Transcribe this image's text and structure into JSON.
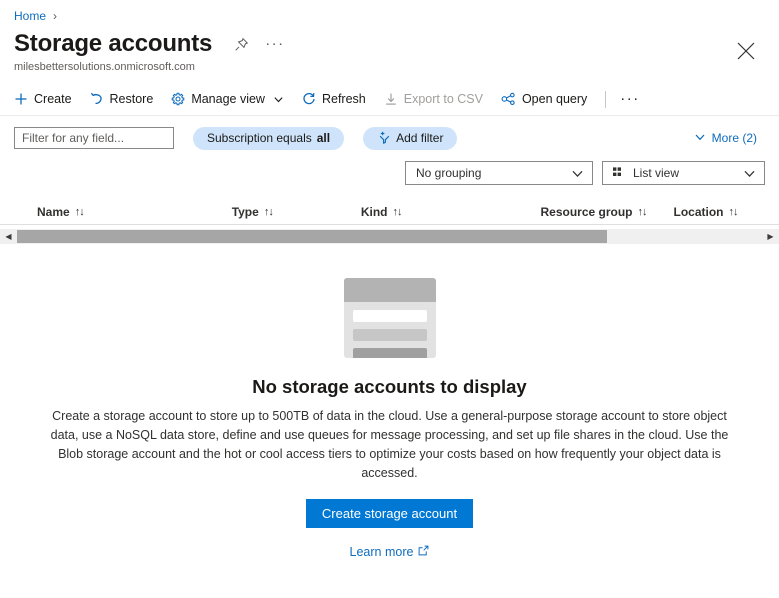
{
  "breadcrumb": {
    "home": "Home",
    "separator": "›"
  },
  "header": {
    "title": "Storage accounts",
    "subtitle": "milesbettersolutions.onmicrosoft.com",
    "pin_icon": "pin-icon",
    "ellipsis": "···",
    "close_icon": "close-icon"
  },
  "commandbar": {
    "items": [
      {
        "label": "Create",
        "icon": "plus-icon",
        "disabled": false
      },
      {
        "label": "Restore",
        "icon": "undo-arrow-icon",
        "disabled": false
      },
      {
        "label": "Manage view",
        "icon": "gear-icon",
        "disabled": false,
        "has_chevron": true
      },
      {
        "label": "Refresh",
        "icon": "refresh-icon",
        "disabled": false
      },
      {
        "label": "Export to CSV",
        "icon": "download-icon",
        "disabled": true
      },
      {
        "label": "Open query",
        "icon": "share-nodes-icon",
        "disabled": false
      }
    ],
    "overflow_ellipsis": "···"
  },
  "filterbar": {
    "filter_placeholder": "Filter for any field...",
    "filter_value": "",
    "subscription_chip": {
      "prefix": "Subscription equals ",
      "value": "all"
    },
    "add_filter_label": "Add filter",
    "add_filter_icon": "add-filter-icon",
    "more_label": "More (2)",
    "more_icon": "chevron-down-icon"
  },
  "selectors": {
    "grouping": {
      "value": "No grouping",
      "chevron": "chevron-down-icon"
    },
    "view": {
      "value": "List view",
      "icon": "list-view-icon",
      "chevron": "chevron-down-icon"
    }
  },
  "table": {
    "columns": [
      {
        "label": "Name",
        "sort": "↑↓"
      },
      {
        "label": "Type",
        "sort": "↑↓"
      },
      {
        "label": "Kind",
        "sort": "↑↓"
      },
      {
        "label": "Resource group",
        "sort": "↑↓"
      },
      {
        "label": "Location",
        "sort": "↑↓"
      }
    ],
    "rows": []
  },
  "scrollbar": {
    "left_arrow": "◀",
    "right_arrow": "▶"
  },
  "empty_state": {
    "illustration": "empty-table-illustration",
    "title": "No storage accounts to display",
    "description": "Create a storage account to store up to 500TB of data in the cloud. Use a general-purpose storage account to store object data, use a NoSQL data store, define and use queues for message processing, and set up file shares in the cloud. Use the Blob storage account and the hot or cool access tiers to optimize your costs based on how frequently your object data is accessed.",
    "primary_button": "Create storage account",
    "learn_more": "Learn more",
    "learn_more_icon": "external-link-icon"
  },
  "colors": {
    "accent": "#0078d4",
    "link": "#0f6cbd",
    "chip_background": "#cfe4fa",
    "disabled_text": "#a19f9d"
  }
}
